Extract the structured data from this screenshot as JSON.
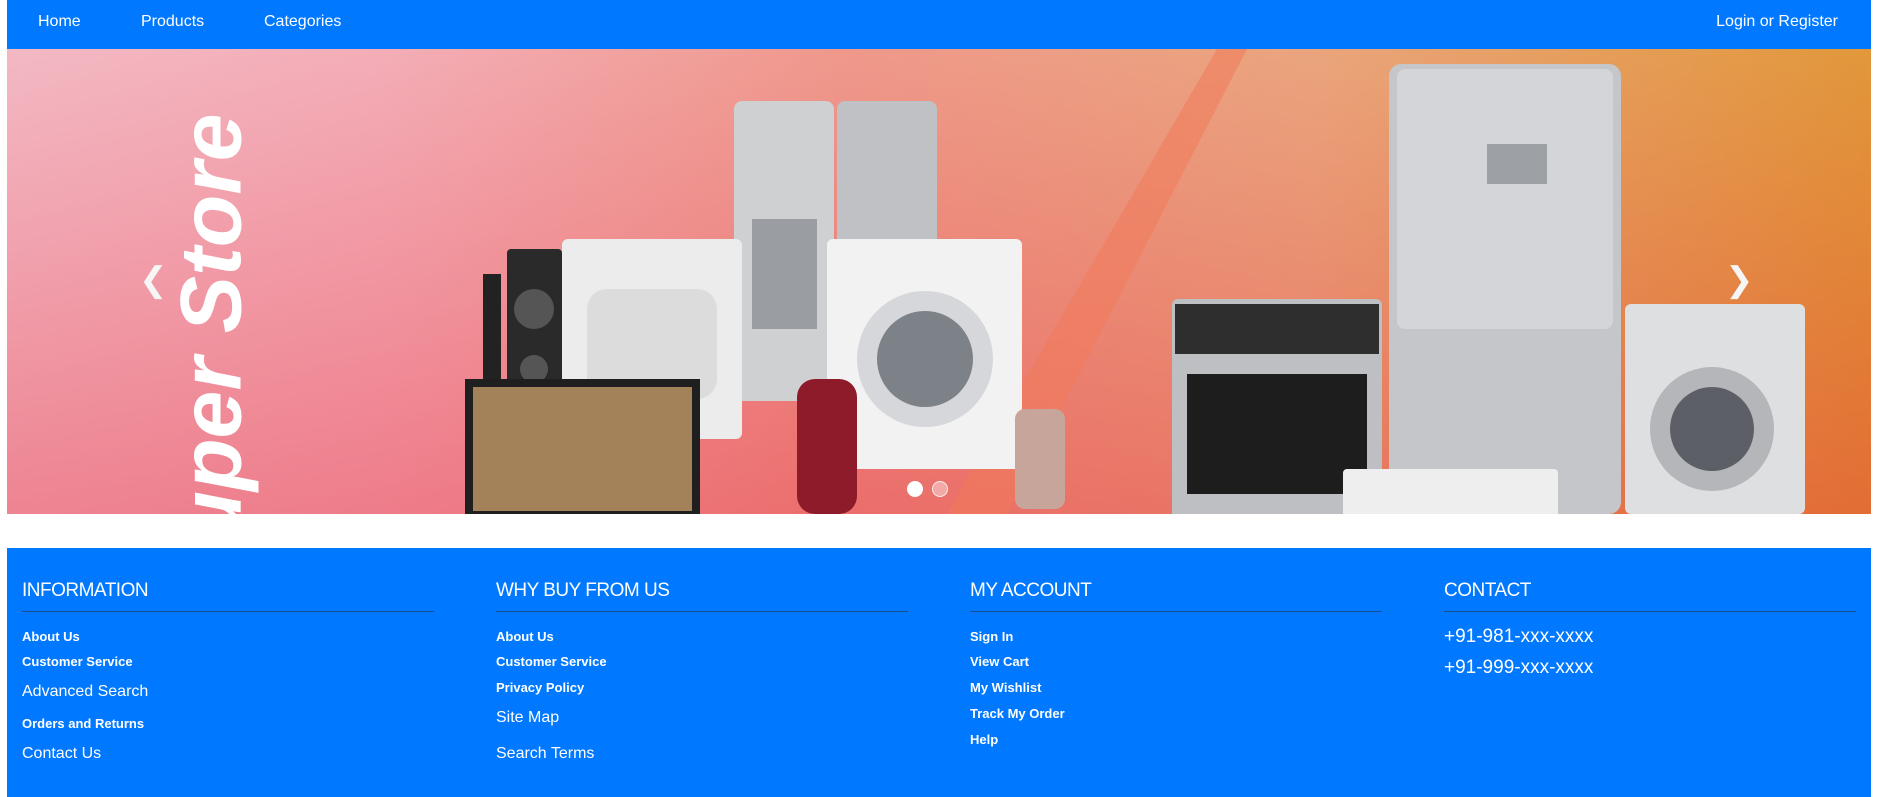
{
  "nav": {
    "home": "Home",
    "products": "Products",
    "categories": "Categories",
    "login": "Login or Register"
  },
  "carousel": {
    "brand_text": "uper Store",
    "prev_icon": "chevron-left-icon",
    "next_icon": "chevron-right-icon",
    "slide_count": 2,
    "active_slide": 1
  },
  "footer": {
    "information": {
      "title": "INFORMATION",
      "links": [
        "About Us",
        "Customer Service",
        "Advanced Search",
        "Orders and Returns",
        "Contact Us"
      ]
    },
    "why_buy": {
      "title": "WHY BUY FROM US",
      "links": [
        "About Us",
        "Customer Service",
        "Privacy Policy",
        "Site Map",
        "Search Terms"
      ]
    },
    "my_account": {
      "title": "MY ACCOUNT",
      "links": [
        "Sign In",
        "View Cart",
        "My Wishlist",
        "Track My Order",
        "Help"
      ]
    },
    "contact": {
      "title": "CONTACT",
      "phones": [
        "+91-981-xxx-xxxx",
        "+91-999-xxx-xxxx"
      ]
    }
  },
  "colors": {
    "primary": "#0078ff",
    "text": "#ffffff"
  }
}
